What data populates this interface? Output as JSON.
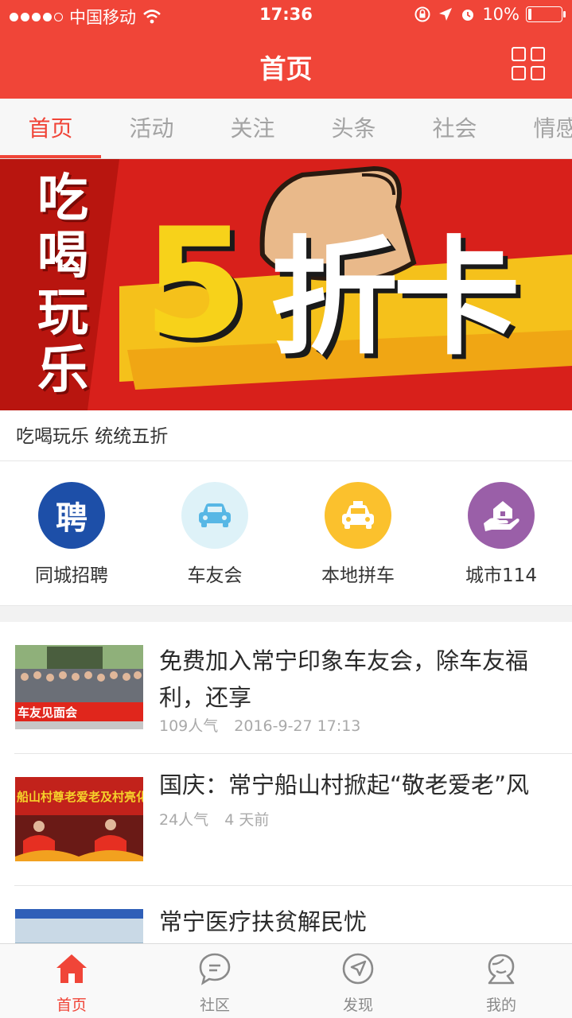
{
  "status_bar": {
    "carrier": "中国移动",
    "time": "17:36",
    "battery_text": "10%",
    "battery_level": 0.1,
    "icons": [
      "signal-dots-icon",
      "wifi-icon",
      "rotation-lock-icon",
      "location-arrow-icon",
      "alarm-icon",
      "battery-icon"
    ]
  },
  "nav": {
    "title": "首页",
    "menu_icon": "grid-icon"
  },
  "tabs": [
    {
      "label": "首页",
      "active": true
    },
    {
      "label": "活动",
      "active": false
    },
    {
      "label": "关注",
      "active": false
    },
    {
      "label": "头条",
      "active": false
    },
    {
      "label": "社会",
      "active": false
    },
    {
      "label": "情感",
      "active": false
    }
  ],
  "banner": {
    "side_text": [
      "吃",
      "喝",
      "玩",
      "乐"
    ],
    "big_number": "5",
    "big_text": "折卡",
    "caption": "吃喝玩乐 统统五折"
  },
  "quick_links": [
    {
      "label": "同城招聘",
      "glyph": "聘",
      "icon": "recruit-icon",
      "color": "#1d4fa8"
    },
    {
      "label": "车友会",
      "glyph": "",
      "icon": "car-icon",
      "color": "#def2f8"
    },
    {
      "label": "本地拼车",
      "glyph": "",
      "icon": "taxi-icon",
      "color": "#fbc12d"
    },
    {
      "label": "城市114",
      "glyph": "",
      "icon": "home-hand-icon",
      "color": "#9a5fa8"
    }
  ],
  "news": [
    {
      "title": "免费加入常宁印象车友会，除车友福利，还享",
      "views": "109人气",
      "time": "2016-9-27 17:13",
      "thumb_text": "车友见面会"
    },
    {
      "title": "国庆：常宁船山村掀起“敬老爱老”风",
      "views": "24人气",
      "time": "4 天前",
      "thumb_text": "船山村尊老爱老及村亮化"
    },
    {
      "title": "常宁医疗扶贫解民忧",
      "views": "",
      "time": "",
      "thumb_text": ""
    }
  ],
  "tabbar": [
    {
      "label": "首页",
      "icon": "home-icon",
      "active": true
    },
    {
      "label": "社区",
      "icon": "chat-bubble-icon",
      "active": false
    },
    {
      "label": "发现",
      "icon": "compass-icon",
      "active": false
    },
    {
      "label": "我的",
      "icon": "user-icon",
      "active": false
    }
  ],
  "colors": {
    "accent": "#f04538",
    "text_primary": "#2a2a2a",
    "text_muted": "#a9a9a9"
  }
}
